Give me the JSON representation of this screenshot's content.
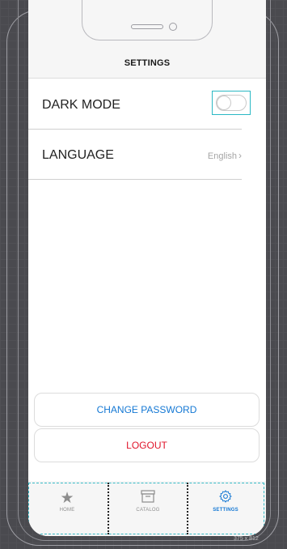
{
  "header": {
    "title": "SETTINGS"
  },
  "settings": {
    "dark_mode_label": "DARK MODE",
    "dark_mode_on": false,
    "language_label": "LANGUAGE",
    "language_value": "English"
  },
  "actions": {
    "change_password": "CHANGE PASSWORD",
    "logout": "LOGOUT"
  },
  "nav": {
    "tabs": [
      {
        "label": "HOME",
        "icon": "star-icon"
      },
      {
        "label": "CATALOG",
        "icon": "archive-icon"
      },
      {
        "label": "SETTINGS",
        "icon": "gear-icon"
      }
    ],
    "active": "SETTINGS"
  },
  "canvas": {
    "size_label": "375 x 812"
  },
  "colors": {
    "accent": "#1478d4",
    "danger": "#e0142a",
    "selection": "#2bb8c4"
  }
}
